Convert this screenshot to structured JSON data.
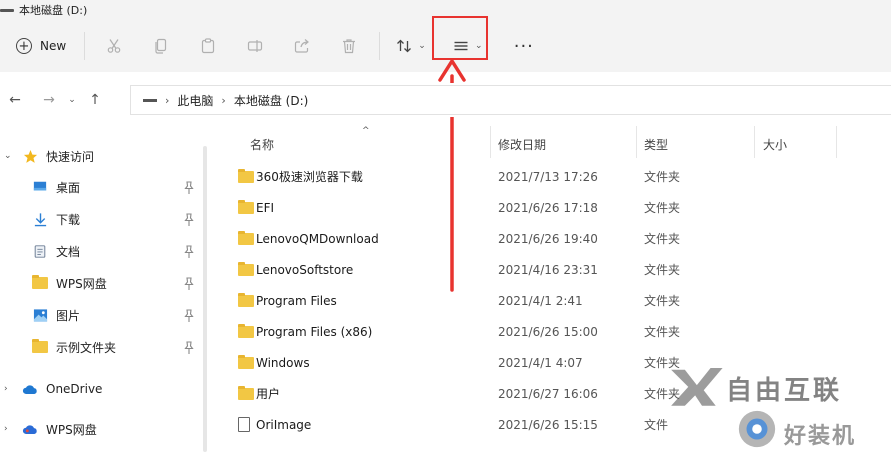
{
  "window": {
    "title": "本地磁盘 (D:)"
  },
  "toolbar": {
    "new_label": "New",
    "icons": [
      "cut-icon",
      "copy-icon",
      "paste-icon",
      "rename-icon",
      "share-icon",
      "delete-icon",
      "sort-icon",
      "view-icon",
      "more-icon"
    ],
    "more_label": "···"
  },
  "annotation": {
    "highlight_color": "#e8332f"
  },
  "address": {
    "crumbs": [
      "此电脑",
      "本地磁盘 (D:)"
    ]
  },
  "sidebar": {
    "quick_access": "快速访问",
    "items": [
      {
        "label": "桌面",
        "icon": "desktop-icon",
        "pinned": true
      },
      {
        "label": "下载",
        "icon": "download-icon",
        "pinned": true
      },
      {
        "label": "文档",
        "icon": "document-icon",
        "pinned": true
      },
      {
        "label": "WPS网盘",
        "icon": "folder-icon",
        "pinned": true
      },
      {
        "label": "图片",
        "icon": "picture-icon",
        "pinned": true
      },
      {
        "label": "示例文件夹",
        "icon": "folder-icon",
        "pinned": true
      }
    ],
    "onedrive": "OneDrive",
    "wps": "WPS网盘"
  },
  "columns": {
    "name": "名称",
    "date": "修改日期",
    "type": "类型",
    "size": "大小"
  },
  "files": [
    {
      "name": "360极速浏览器下载",
      "date": "2021/7/13 17:26",
      "type": "文件夹",
      "kind": "folder"
    },
    {
      "name": "EFI",
      "date": "2021/6/26 17:18",
      "type": "文件夹",
      "kind": "folder"
    },
    {
      "name": "LenovoQMDownload",
      "date": "2021/6/26 19:40",
      "type": "文件夹",
      "kind": "folder"
    },
    {
      "name": "LenovoSoftstore",
      "date": "2021/4/16 23:31",
      "type": "文件夹",
      "kind": "folder"
    },
    {
      "name": "Program Files",
      "date": "2021/4/1 2:41",
      "type": "文件夹",
      "kind": "folder"
    },
    {
      "name": "Program Files (x86)",
      "date": "2021/6/26 15:00",
      "type": "文件夹",
      "kind": "folder"
    },
    {
      "name": "Windows",
      "date": "2021/4/1 4:07",
      "type": "文件夹",
      "kind": "folder"
    },
    {
      "name": "用户",
      "date": "2021/6/27 16:06",
      "type": "文件夹",
      "kind": "folder"
    },
    {
      "name": "OriImage",
      "date": "2021/6/26 15:15",
      "type": "文件",
      "kind": "file"
    }
  ],
  "watermark": {
    "line1": "自由互联",
    "line2": "好装机"
  }
}
